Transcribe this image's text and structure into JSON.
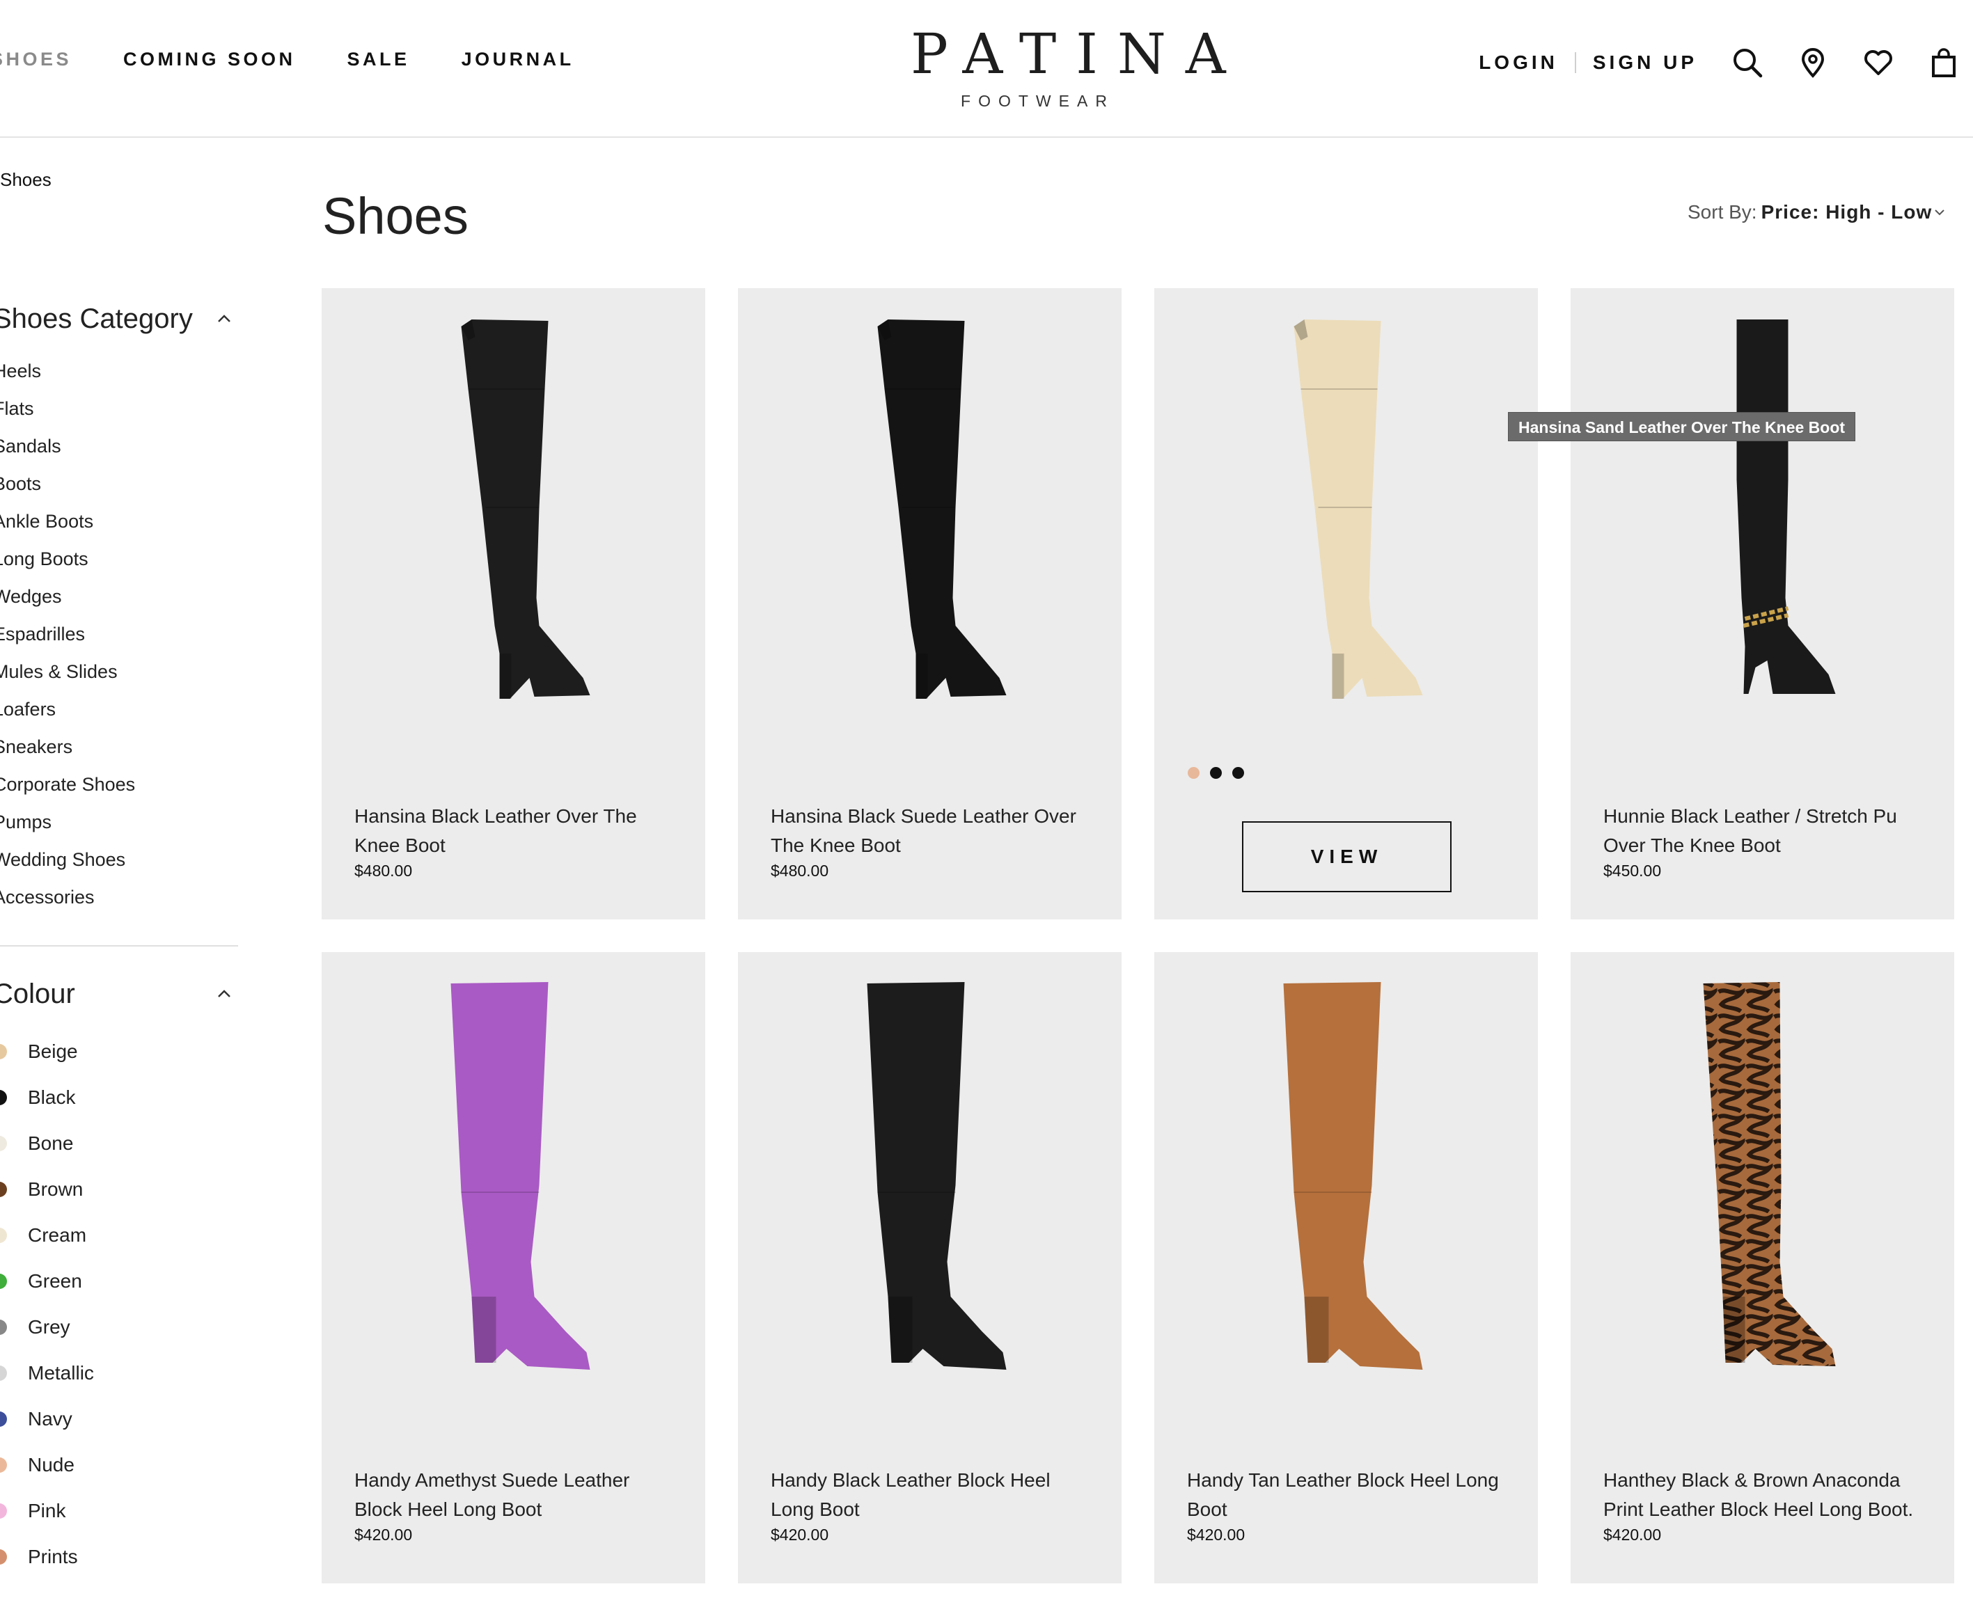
{
  "header": {
    "nav": [
      "SHOES",
      "COMING SOON",
      "SALE",
      "JOURNAL"
    ],
    "brand": {
      "name": "PATINA",
      "sub": "FOOTWEAR"
    },
    "login": "LOGIN",
    "signup": "SIGN UP",
    "icons": [
      "search-icon",
      "location-icon",
      "heart-icon",
      "bag-icon"
    ]
  },
  "breadcrumb": "Shoes",
  "page_title": "Shoes",
  "sort": {
    "label": "Sort By:",
    "value": "Price: High - Low"
  },
  "filters": {
    "category": {
      "title": "Shoes Category",
      "items": [
        "Heels",
        "Flats",
        "Sandals",
        "Boots",
        "Ankle Boots",
        "Long Boots",
        "Wedges",
        "Espadrilles",
        "Mules & Slides",
        "Loafers",
        "Sneakers",
        "Corporate Shoes",
        "Pumps",
        "Wedding Shoes",
        "Accessories"
      ]
    },
    "colour": {
      "title": "Colour",
      "items": [
        {
          "label": "Beige",
          "color": "#e7c9a0"
        },
        {
          "label": "Black",
          "color": "#111111"
        },
        {
          "label": "Bone",
          "color": "#eeeae0"
        },
        {
          "label": "Brown",
          "color": "#6b4020"
        },
        {
          "label": "Cream",
          "color": "#efe6d2"
        },
        {
          "label": "Green",
          "color": "#3fae3a"
        },
        {
          "label": "Grey",
          "color": "#888888"
        },
        {
          "label": "Metallic",
          "color": "#d6d6d6"
        },
        {
          "label": "Navy",
          "color": "#3d4f9a"
        },
        {
          "label": "Nude",
          "color": "#ebb99a"
        },
        {
          "label": "Pink",
          "color": "#f2b6dc"
        },
        {
          "label": "Prints",
          "color": "#d4906e"
        }
      ]
    }
  },
  "products": [
    {
      "name": "Hansina Black Leather Over The Knee Boot",
      "price": "$480.00",
      "boot_color": "#1d1d1d",
      "style": "otk"
    },
    {
      "name": "Hansina Black Suede Leather Over The Knee Boot",
      "price": "$480.00",
      "boot_color": "#141414",
      "style": "otk"
    },
    {
      "name": "Hansina Sand Leather Over The Knee Boot",
      "price": "",
      "boot_color": "#ecdcb9",
      "style": "otk",
      "hover": true,
      "view_label": "VIEW",
      "swatches": [
        "#e8b89a",
        "#111111",
        "#111111"
      ]
    },
    {
      "name": "Hunnie Black Leather / Stretch Pu Over The Knee Boot",
      "price": "$450.00",
      "boot_color": "#1a1a1a",
      "style": "stiletto"
    },
    {
      "name": "Handy Amethyst Suede Leather Block Heel Long Boot",
      "price": "$420.00",
      "boot_color": "#a95ac4",
      "style": "knee"
    },
    {
      "name": "Handy Black Leather Block Heel Long Boot",
      "price": "$420.00",
      "boot_color": "#1c1c1c",
      "style": "knee"
    },
    {
      "name": "Handy Tan Leather Block Heel Long Boot",
      "price": "$420.00",
      "boot_color": "#b5703c",
      "style": "knee"
    },
    {
      "name": "Hanthey Black & Brown Anaconda Print Leather Block Heel Long Boot.",
      "price": "$420.00",
      "boot_color": "#7a4a2a",
      "style": "snake"
    }
  ],
  "tooltip": "Hansina Sand Leather Over The Knee Boot"
}
